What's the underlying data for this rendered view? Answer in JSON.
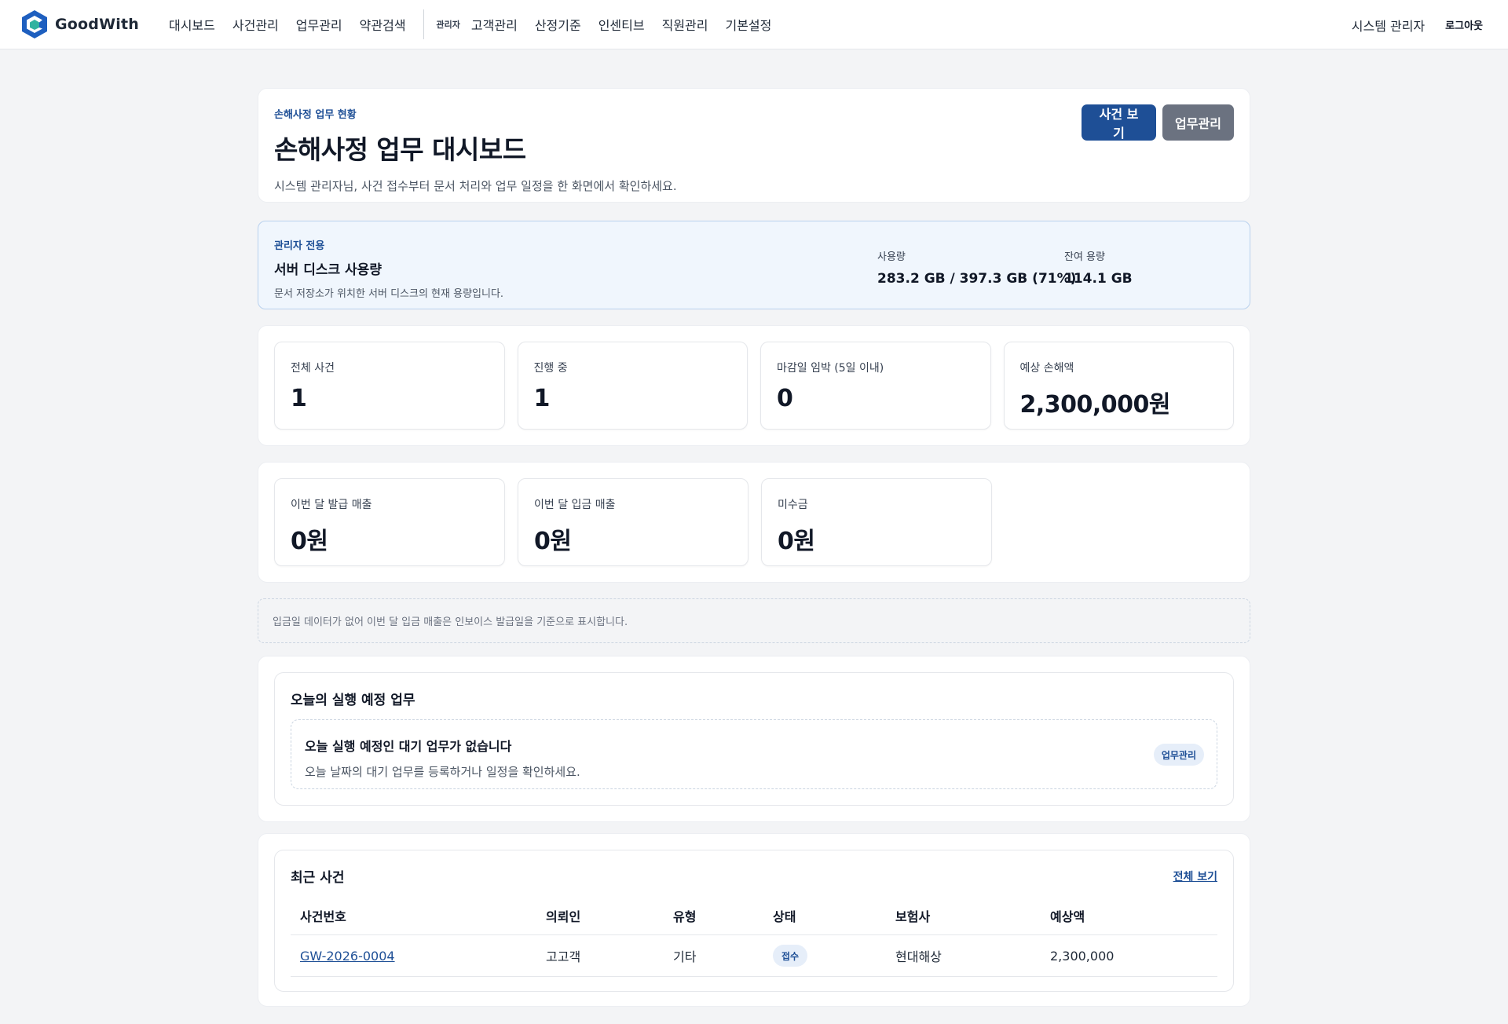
{
  "brand": {
    "name": "GoodWith"
  },
  "nav": {
    "items": [
      "대시보드",
      "사건관리",
      "업무관리",
      "약관검색"
    ],
    "admin_tag": "관리자",
    "admin_items": [
      "고객관리",
      "산정기준",
      "인센티브",
      "직원관리",
      "기본설정"
    ],
    "user": "시스템 관리자",
    "logout": "로그아웃"
  },
  "hero": {
    "eyebrow": "손해사정 업무 현황",
    "title": "손해사정 업무 대시보드",
    "description": "시스템 관리자님, 사건 접수부터 문서 처리와 업무 일정을 한 화면에서 확인하세요.",
    "btn_cases": "사건 보기",
    "btn_tasks": "업무관리"
  },
  "disk": {
    "eyebrow": "관리자 전용",
    "title": "서버 디스크 사용량",
    "description": "문서 저장소가 위치한 서버 디스크의 현재 용량입니다.",
    "usage_label": "사용량",
    "usage_value": "283.2 GB / 397.3 GB (71%)",
    "free_label": "잔여 용량",
    "free_value": "114.1 GB"
  },
  "metrics_cases": [
    {
      "label": "전체 사건",
      "value": "1"
    },
    {
      "label": "진행 중",
      "value": "1"
    },
    {
      "label": "마감일 임박 (5일 이내)",
      "value": "0"
    },
    {
      "label": "예상 손해액",
      "value": "2,300,000원"
    }
  ],
  "metrics_sales": [
    {
      "label": "이번 달 발급 매출",
      "value": "0원"
    },
    {
      "label": "이번 달 입금 매출",
      "value": "0원"
    },
    {
      "label": "미수금",
      "value": "0원"
    }
  ],
  "note": "입금일 데이터가 없어 이번 달 입금 매출은 인보이스 발급일을 기준으로 표시합니다.",
  "today": {
    "title": "오늘의 실행 예정 업무",
    "empty_title": "오늘 실행 예정인 대기 업무가 없습니다",
    "empty_desc": "오늘 날짜의 대기 업무를 등록하거나 일정을 확인하세요.",
    "chip": "업무관리"
  },
  "recent": {
    "title": "최근 사건",
    "view_all": "전체 보기",
    "columns": [
      "사건번호",
      "의뢰인",
      "유형",
      "상태",
      "보험사",
      "예상액"
    ],
    "rows": [
      {
        "case_no": "GW-2026-0004",
        "client": "고고객",
        "type": "기타",
        "status": "접수",
        "insurer": "현대해상",
        "amount": "2,300,000"
      }
    ]
  }
}
